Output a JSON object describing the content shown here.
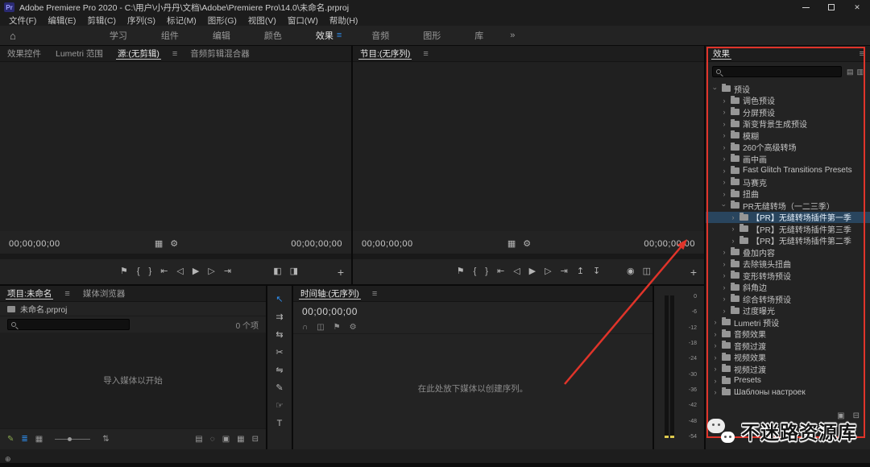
{
  "titlebar": {
    "app_icon_text": "Pr",
    "title": "Adobe Premiere Pro 2020 - C:\\用户\\小丹丹\\文档\\Adobe\\Premiere Pro\\14.0\\未命名.prproj",
    "window_controls": [
      "minimize-button",
      "maximize-button",
      "close-button"
    ]
  },
  "menubar": {
    "items": [
      "文件(F)",
      "编辑(E)",
      "剪辑(C)",
      "序列(S)",
      "标记(M)",
      "图形(G)",
      "视图(V)",
      "窗口(W)",
      "帮助(H)"
    ]
  },
  "workspace": {
    "tabs": [
      {
        "label": "学习",
        "active": false
      },
      {
        "label": "组件",
        "active": false
      },
      {
        "label": "编辑",
        "active": false
      },
      {
        "label": "颜色",
        "active": false
      },
      {
        "label": "效果",
        "active": true
      },
      {
        "label": "音频",
        "active": false
      },
      {
        "label": "图形",
        "active": false
      },
      {
        "label": "库",
        "active": false
      }
    ]
  },
  "source_monitor": {
    "tabs": [
      {
        "label": "效果控件",
        "active": false
      },
      {
        "label": "Lumetri 范围",
        "active": false
      },
      {
        "label": "源:(无剪辑)",
        "active": true
      },
      {
        "label": "音频剪辑混合器",
        "active": false
      }
    ],
    "timecode_current": "00;00;00;00",
    "timecode_duration": "00;00;00;00",
    "info_icons": [
      "zoom-level-icon",
      "monitor-settings-icon"
    ],
    "transport_icons": [
      "add-marker-icon",
      "mark-in-icon",
      "mark-out-icon",
      "go-to-in-icon",
      "step-back-icon",
      "play-icon",
      "step-forward-icon",
      "go-to-out-icon"
    ],
    "transport_right_icons": [
      "insert-icon",
      "overwrite-icon"
    ]
  },
  "program_monitor": {
    "tab": "节目:(无序列)",
    "timecode_current": "00;00;00;00",
    "timecode_duration": "00;00;00;00",
    "info_icons": [
      "zoom-level-icon",
      "monitor-settings-icon"
    ],
    "transport_icons": [
      "add-marker-icon",
      "mark-in-icon",
      "mark-out-icon",
      "go-to-in-icon",
      "step-back-icon",
      "play-icon",
      "step-forward-icon",
      "go-to-out-icon",
      "lift-icon",
      "extract-icon"
    ],
    "transport_right_icons": [
      "export-frame-icon",
      "compare-icon"
    ]
  },
  "project_panel": {
    "tabs": [
      {
        "label": "项目:未命名",
        "active": true
      },
      {
        "label": "媒体浏览器",
        "active": false
      }
    ],
    "project_file": "未命名.prproj",
    "search_placeholder": "",
    "item_count": "0 个项",
    "empty_message": "导入媒体以开始",
    "toolbar_left": [
      "pencil-icon",
      "list-view-icon",
      "icon-view-icon",
      "zoom-slider",
      "sort-icon"
    ],
    "toolbar_right": [
      "automate-sequence-icon",
      "find-icon",
      "new-bin-icon",
      "new-item-icon",
      "delete-icon"
    ]
  },
  "tools": [
    {
      "name": "selection-tool",
      "active": true
    },
    {
      "name": "track-select-tool",
      "active": false
    },
    {
      "name": "ripple-edit-tool",
      "active": false
    },
    {
      "name": "razor-tool",
      "active": false
    },
    {
      "name": "slip-tool",
      "active": false
    },
    {
      "name": "pen-tool",
      "active": false
    },
    {
      "name": "hand-tool",
      "active": false
    },
    {
      "name": "type-tool",
      "active": false
    }
  ],
  "timeline_panel": {
    "tab": "时间轴:(无序列)",
    "timecode": "00;00;00;00",
    "toolbar_icons": [
      "snap-icon",
      "linked-selection-icon",
      "add-marker-icon",
      "timeline-settings-icon"
    ],
    "empty_message": "在此处放下媒体以创建序列。"
  },
  "audio_meter": {
    "scale_labels": [
      "0",
      "-6",
      "-12",
      "-18",
      "-24",
      "-30",
      "-36",
      "-42",
      "-48",
      "-54"
    ]
  },
  "effects_panel": {
    "tab": "效果",
    "search_placeholder": "",
    "filter_icons": [
      "accelerated-effects-filter-icon",
      "color-depth-filter-icon"
    ],
    "bottom_icons": [
      "new-custom-bin-icon",
      "delete-icon"
    ],
    "tree": [
      {
        "label": "预设",
        "level": 0,
        "expanded": true,
        "selected": false
      },
      {
        "label": "调色预设",
        "level": 1,
        "expanded": false,
        "selected": false
      },
      {
        "label": "分屏预设",
        "level": 1,
        "expanded": false,
        "selected": false
      },
      {
        "label": "渐变背景生成预设",
        "level": 1,
        "expanded": false,
        "selected": false
      },
      {
        "label": "模糊",
        "level": 1,
        "expanded": false,
        "selected": false
      },
      {
        "label": "260个高级转场",
        "level": 1,
        "expanded": false,
        "selected": false
      },
      {
        "label": "画中画",
        "level": 1,
        "expanded": false,
        "selected": false
      },
      {
        "label": "Fast Glitch Transitions Presets",
        "level": 1,
        "expanded": false,
        "selected": false
      },
      {
        "label": "马赛克",
        "level": 1,
        "expanded": false,
        "selected": false
      },
      {
        "label": "扭曲",
        "level": 1,
        "expanded": false,
        "selected": false
      },
      {
        "label": "PR无缝转场（一二三季）",
        "level": 1,
        "expanded": true,
        "selected": false
      },
      {
        "label": "【PR】无缝转场插件第一季",
        "level": 2,
        "expanded": false,
        "selected": true
      },
      {
        "label": "【PR】无缝转场插件第三季",
        "level": 2,
        "expanded": false,
        "selected": false
      },
      {
        "label": "【PR】无缝转场插件第二季",
        "level": 2,
        "expanded": false,
        "selected": false
      },
      {
        "label": "叠加内容",
        "level": 1,
        "expanded": false,
        "selected": false
      },
      {
        "label": "去除镜头扭曲",
        "level": 1,
        "expanded": false,
        "selected": false
      },
      {
        "label": "变形转场预设",
        "level": 1,
        "expanded": false,
        "selected": false
      },
      {
        "label": "斜角边",
        "level": 1,
        "expanded": false,
        "selected": false
      },
      {
        "label": "综合转场预设",
        "level": 1,
        "expanded": false,
        "selected": false
      },
      {
        "label": "过度曝光",
        "level": 1,
        "expanded": false,
        "selected": false
      },
      {
        "label": "Lumetri 预设",
        "level": 0,
        "expanded": false,
        "selected": false
      },
      {
        "label": "音频效果",
        "level": 0,
        "expanded": false,
        "selected": false
      },
      {
        "label": "音频过渡",
        "level": 0,
        "expanded": false,
        "selected": false
      },
      {
        "label": "视频效果",
        "level": 0,
        "expanded": false,
        "selected": false
      },
      {
        "label": "视频过渡",
        "level": 0,
        "expanded": false,
        "selected": false
      },
      {
        "label": "Presets",
        "level": 0,
        "expanded": false,
        "selected": false
      },
      {
        "label": "Шаблоны настроек",
        "level": 0,
        "expanded": false,
        "selected": false
      }
    ]
  },
  "watermark": {
    "text": "不迷路资源库"
  },
  "colors": {
    "accent_blue": "#2d8ceb",
    "annotation_red": "#e0342a",
    "selected_row": "#29455e"
  }
}
